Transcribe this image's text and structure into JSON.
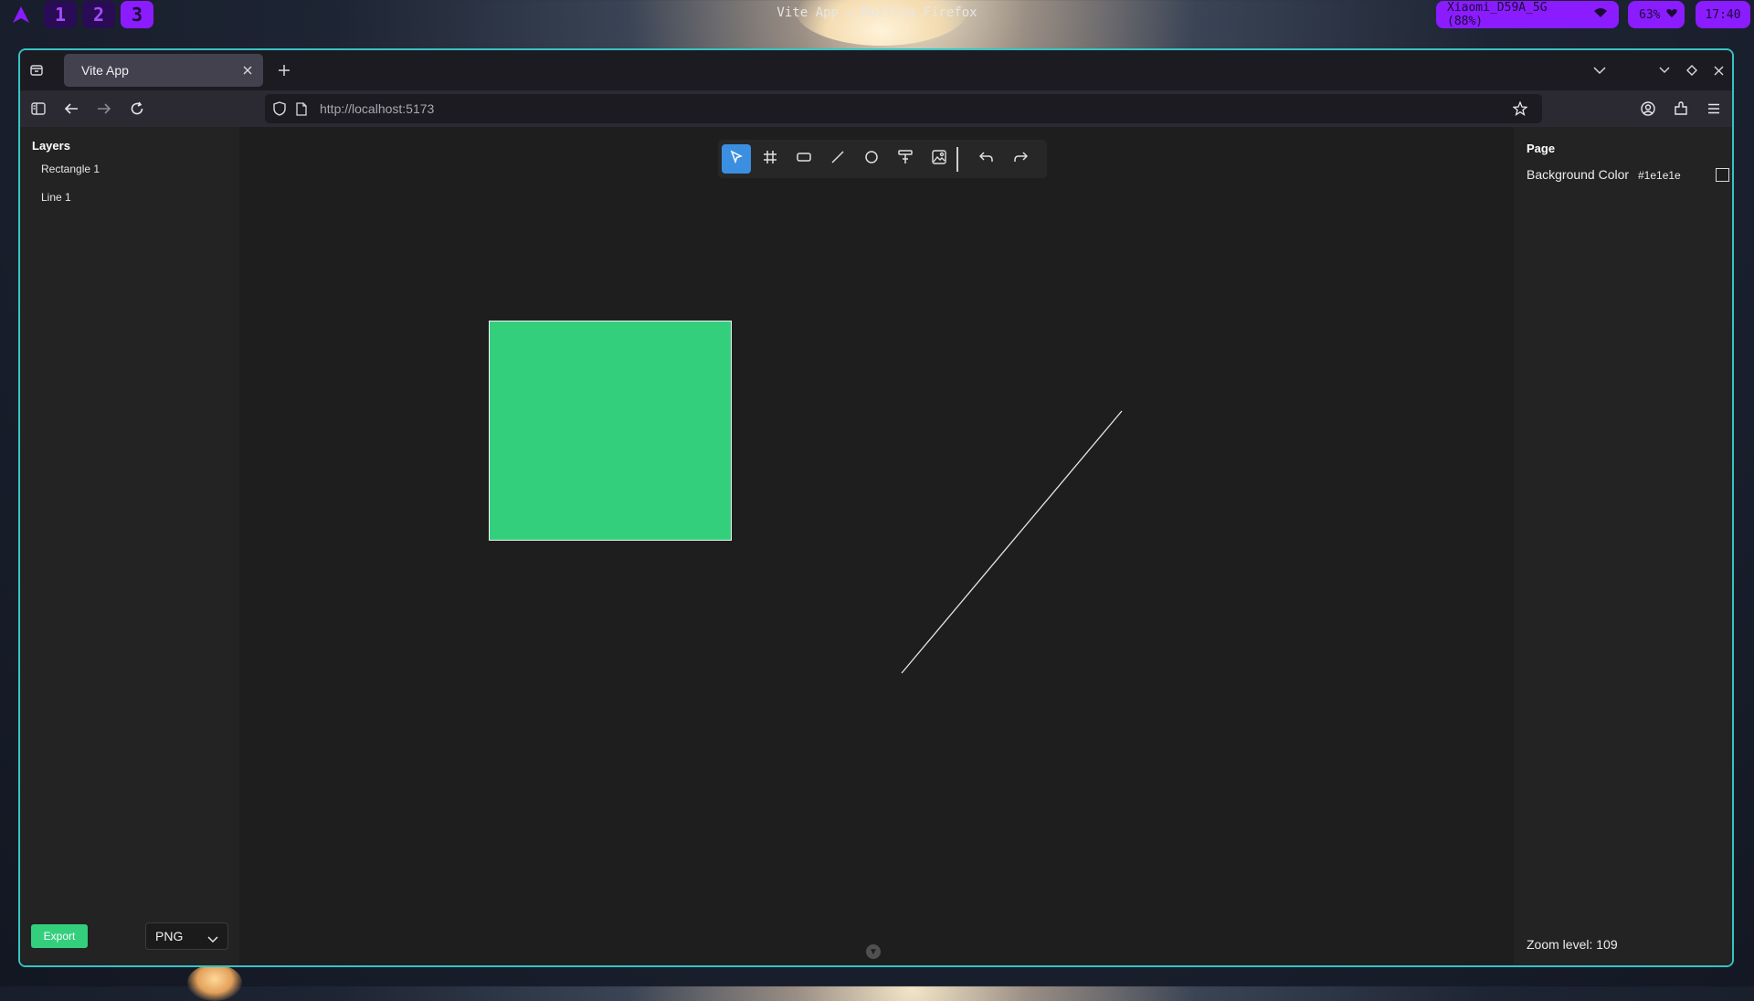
{
  "desktop": {
    "workspaces": [
      "1",
      "2",
      "3"
    ],
    "active_workspace": "3",
    "window_title": "Vite App — Mozilla Firefox",
    "wifi": "Xiaomi_D59A_5G (88%)",
    "battery": "63%",
    "clock": "17:40",
    "accent_color": "#8a1cff"
  },
  "browser": {
    "tab_title": "Vite App",
    "url_host": "http://localhost",
    "url_port": ":5173",
    "frame_color": "#36c4c4"
  },
  "app": {
    "layers_title": "Layers",
    "layers": [
      {
        "label": "Rectangle 1"
      },
      {
        "label": "Line 1"
      }
    ],
    "export_label": "Export",
    "export_format": "PNG",
    "toolbar_tools": [
      "select-tool",
      "frame-tool",
      "rectangle-tool",
      "line-tool",
      "ellipse-tool",
      "text-tool",
      "image-tool",
      "undo",
      "redo"
    ],
    "active_tool": "select-tool",
    "page_title": "Page",
    "background_color_label": "Background Color",
    "background_color_value": "#1e1e1e",
    "background_color_text": "#1e1e1e",
    "zoom_label": "Zoom level: 109",
    "rect_fill": "#33cf7d"
  }
}
